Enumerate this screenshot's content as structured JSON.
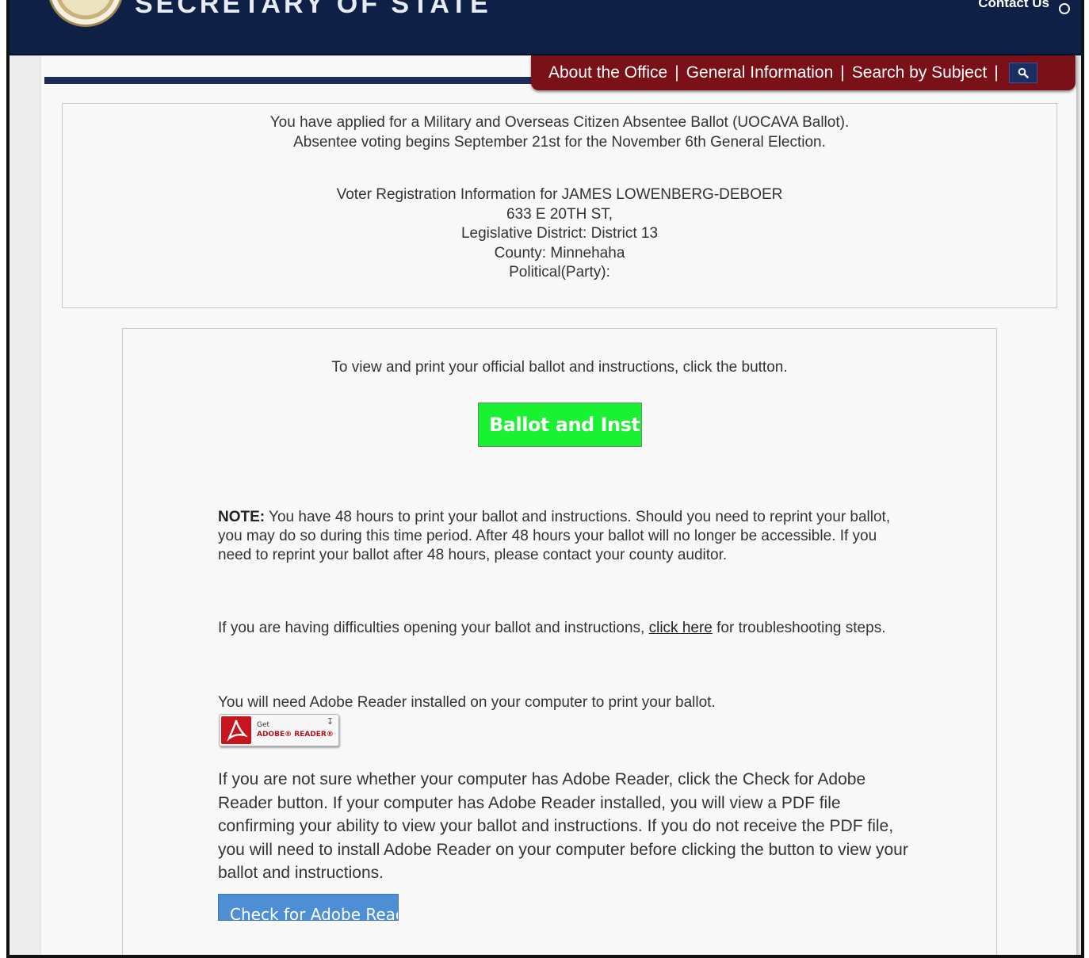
{
  "header": {
    "site_title": "SECRETARY OF STATE",
    "contact_label": "Contact Us"
  },
  "nav": {
    "items": [
      "About the Office",
      "General Information",
      "Search by Subject"
    ],
    "separator": "|"
  },
  "info": {
    "applied_line1": "You have applied for a Military and Overseas Citizen Absentee Ballot (UOCAVA Ballot).",
    "applied_line2": "Absentee voting begins September 21st for the November 6th General Election.",
    "voter_heading": "Voter Registration Information for JAMES LOWENBERG-DEBOER",
    "address": "633 E 20TH ST,",
    "district": "Legislative District: District 13",
    "county": "County: Minnehaha",
    "party": "Political(Party):"
  },
  "ballot": {
    "view_print_text": "To view and print your official ballot and instructions, click the button.",
    "ballot_button_label": "Ballot and Instructions",
    "note_label": "NOTE:",
    "note_text": " You have 48 hours to print your ballot and instructions. Should you need to reprint your ballot, you may do so during this time period. After 48 hours your ballot will no longer be accessible. If you need to reprint your ballot after 48 hours, please contact your county auditor.",
    "difficult_before": "If you are having difficulties opening your ballot and instructions, ",
    "difficult_link": "click here",
    "difficult_after": " for troubleshooting steps.",
    "adobe_need_text": "You will need Adobe Reader installed on your computer to print your ballot.",
    "adobe_badge_get": "Get",
    "adobe_badge_reader": "ADOBE® READER®",
    "adobe_check_text": "If you are not sure whether your computer has Adobe Reader, click the Check for Adobe Reader button. If your computer has Adobe Reader installed, you will view a PDF file confirming your ability to view your ballot and instructions. If you do not receive the PDF file, you will need to install Adobe Reader on your computer before clicking the button to view your ballot and instructions.",
    "check_adobe_button_label": "Check for Adobe Reader"
  },
  "colors": {
    "header_navy": "#0e2045",
    "nav_red": "#7a1018",
    "ballot_button_green": "#19f230",
    "check_button_blue": "#4d8ed4"
  }
}
